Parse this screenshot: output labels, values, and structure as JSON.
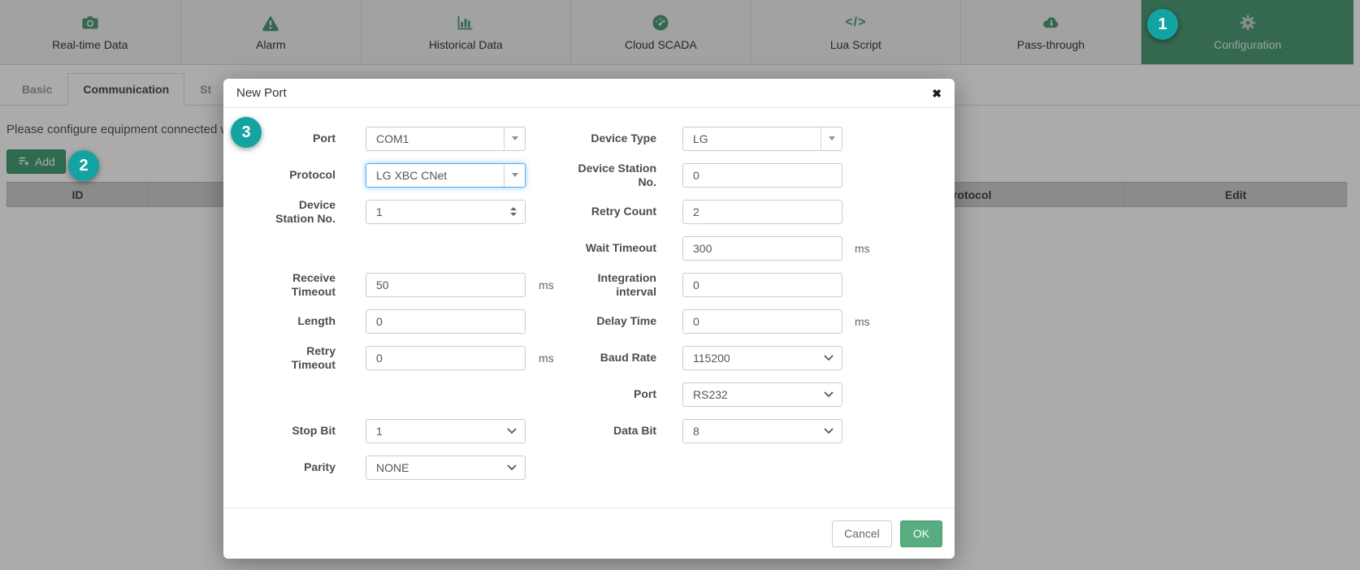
{
  "colors": {
    "accent_green": "#4e9c77",
    "add_button_green": "#47a077",
    "ok_button_green": "#57ac80",
    "badge_teal": "#14a3a3",
    "focus_blue": "#5cacee"
  },
  "nav": {
    "items": [
      {
        "label": "Real-time Data",
        "icon": "camera-icon",
        "active": false
      },
      {
        "label": "Alarm",
        "icon": "warning-icon",
        "active": false
      },
      {
        "label": "Historical Data",
        "icon": "bar-chart-icon",
        "active": false
      },
      {
        "label": "Cloud SCADA",
        "icon": "gauge-icon",
        "active": false
      },
      {
        "label": "Lua Script",
        "icon": "code-icon",
        "active": false
      },
      {
        "label": "Pass-through",
        "icon": "cloud-download-icon",
        "active": false
      },
      {
        "label": "Configuration",
        "icon": "gear-icon",
        "active": true
      }
    ],
    "code_glyph": "</>"
  },
  "tabs": {
    "items": [
      {
        "label": "Basic",
        "active": false
      },
      {
        "label": "Communication",
        "active": true
      },
      {
        "label": "St",
        "active": false
      }
    ]
  },
  "content": {
    "hint": "Please configure equipment connected w",
    "add_button": "Add",
    "table_headers": [
      "ID",
      "",
      "Protocol",
      "Edit"
    ]
  },
  "badges": {
    "step1": "1",
    "step2": "2",
    "step3": "3"
  },
  "modal": {
    "title": "New Port",
    "close_glyph": "✖",
    "fields": [
      {
        "label": "Port",
        "value": "COM1",
        "control": "combobox",
        "suffix": ""
      },
      {
        "label": "Device Type",
        "value": "LG",
        "control": "combobox",
        "suffix": ""
      },
      {
        "label": "Protocol",
        "value": "LG XBC CNet",
        "control": "combobox",
        "suffix": "",
        "focused": true
      },
      {
        "label": "Device Station No.",
        "value": "0",
        "control": "input",
        "suffix": ""
      },
      {
        "label": "Device Station No.",
        "value": "1",
        "control": "number",
        "suffix": ""
      },
      {
        "label": "Retry Count",
        "value": "2",
        "control": "input",
        "suffix": ""
      },
      {
        "label": "Wait Timeout",
        "value": "300",
        "control": "input",
        "suffix": "ms"
      },
      {
        "label": "Receive Timeout",
        "value": "50",
        "control": "input",
        "suffix": "ms"
      },
      {
        "label": "Integration interval",
        "value": "0",
        "control": "input",
        "suffix": ""
      },
      {
        "label": "Length",
        "value": "0",
        "control": "input",
        "suffix": ""
      },
      {
        "label": "Delay Time",
        "value": "0",
        "control": "input",
        "suffix": "ms"
      },
      {
        "label": "Retry Timeout",
        "value": "0",
        "control": "input",
        "suffix": "ms"
      },
      {
        "label": "Baud Rate",
        "value": "115200",
        "control": "select",
        "suffix": ""
      },
      {
        "label": "Port",
        "value": "RS232",
        "control": "select",
        "suffix": ""
      },
      {
        "label": "Stop Bit",
        "value": "1",
        "control": "select",
        "suffix": ""
      },
      {
        "label": "Data Bit",
        "value": "8",
        "control": "select",
        "suffix": ""
      },
      {
        "label": "Parity",
        "value": "NONE",
        "control": "select",
        "suffix": ""
      }
    ],
    "footer": {
      "cancel_label": "Cancel",
      "ok_label": "OK"
    }
  }
}
